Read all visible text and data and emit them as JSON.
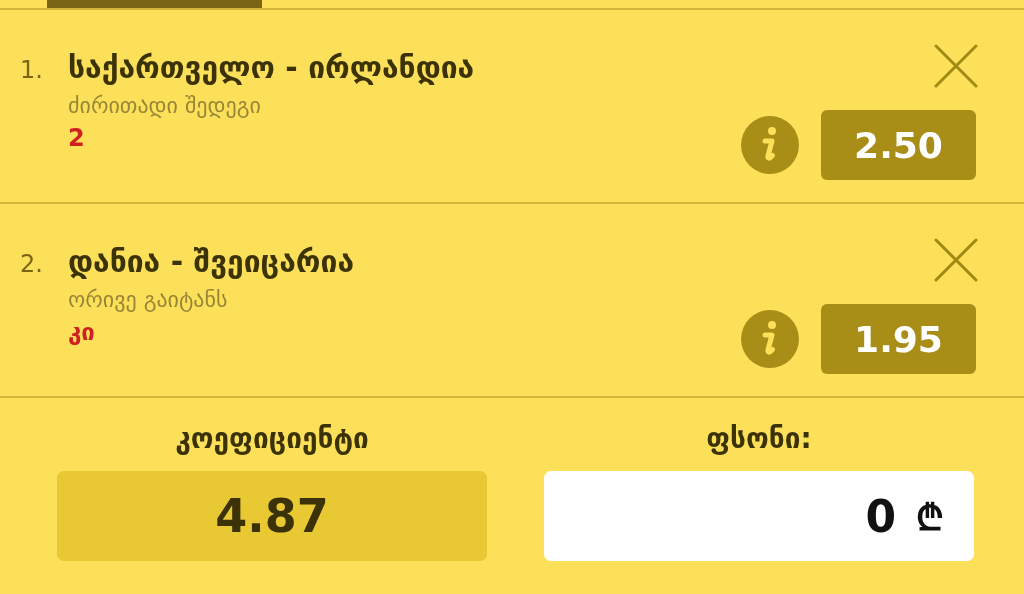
{
  "bets": [
    {
      "number": "1.",
      "match": "საქართველო - ირლანდია",
      "market": "ძირითადი შედეგი",
      "pick": "2",
      "odds": "2.50"
    },
    {
      "number": "2.",
      "match": "დანია - შვეიცარია",
      "market": "ორივე გაიტანს",
      "pick": "კი",
      "odds": "1.95"
    }
  ],
  "summary": {
    "odds_label": "კოეფიციენტი",
    "total_odds": "4.87",
    "stake_label": "ფსონი:",
    "stake": "0",
    "currency": "₾"
  }
}
